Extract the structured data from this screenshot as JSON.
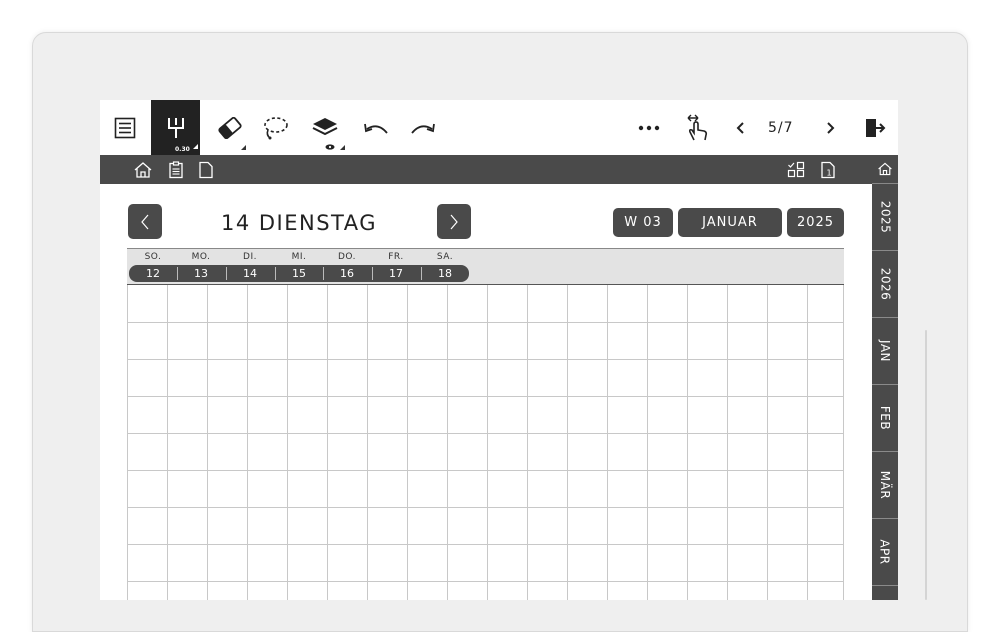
{
  "toolbar": {
    "pen_size": "0.30",
    "page_counter": "5/7",
    "icons": [
      "menu-list-icon",
      "pen-icon",
      "eraser-icon",
      "lasso-icon",
      "layers-icon",
      "undo-icon",
      "redo-icon",
      "more-icon",
      "swipe-gesture-icon",
      "prev-page-icon",
      "next-page-icon",
      "exit-icon"
    ]
  },
  "navbar": {
    "icons": [
      "home-icon",
      "clipboard-icon",
      "page-icon",
      "layout-grid-icon",
      "page-number-icon"
    ]
  },
  "header": {
    "day_title": "14 DIENSTAG",
    "week": "W 03",
    "month": "JANUAR",
    "year": "2025"
  },
  "week_strip": {
    "days": [
      {
        "label": "SO.",
        "num": "12"
      },
      {
        "label": "MO.",
        "num": "13"
      },
      {
        "label": "DI.",
        "num": "14"
      },
      {
        "label": "MI.",
        "num": "15"
      },
      {
        "label": "DO.",
        "num": "16"
      },
      {
        "label": "FR.",
        "num": "17"
      },
      {
        "label": "SA.",
        "num": "18"
      }
    ]
  },
  "side_tabs": [
    "2025",
    "2026",
    "JAN",
    "FEB",
    "MÄR",
    "APR"
  ],
  "colors": {
    "dark": "#4a4a4a",
    "grid": "#c8c8c8"
  }
}
